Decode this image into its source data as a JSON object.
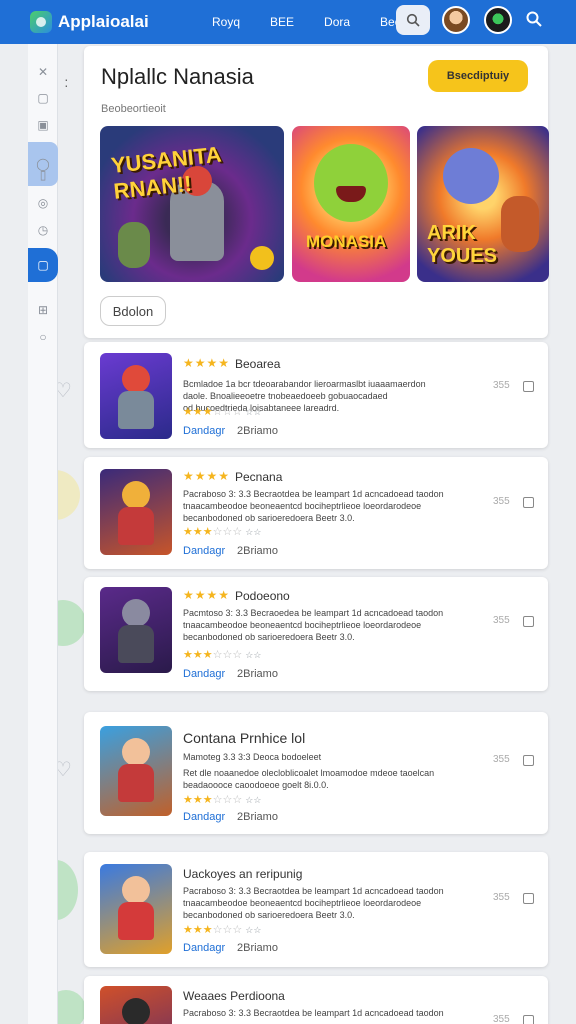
{
  "header": {
    "app_title": "Applaioalai",
    "nav": [
      "Royq",
      "BEE",
      "Dora",
      "Beo"
    ],
    "colors": {
      "bar": "#1f6fd6",
      "accent": "#f6c41b"
    }
  },
  "sidebar": {
    "icons": [
      "close-icon",
      "apps-icon",
      "box-icon",
      "chat-icon",
      "mobile-icon",
      "gamepad-icon",
      "clock-icon",
      "store-icon",
      "add-icon",
      "circle-icon"
    ]
  },
  "hero": {
    "title": "Nplallc Nanasia",
    "subtitle": "Beobeortieoit",
    "cta_label": "Bsecdiptuiy",
    "banners": [
      "YUSANITA RNAN!!",
      "MONASIA",
      "ARIK YOUES"
    ],
    "chip_label": "Bdolon"
  },
  "cards": [
    {
      "stars": "★★★★",
      "title": "Beoarea",
      "desc": "Bcmladoe 1a bcr tdeoarabandor lieroarmaslbt iuaaamaerdon daole. Bnoalieeoetre tnobeaedoeeb gobuaocadaed od.bucoedtrieda loisabtaneee lareadrd.",
      "rating_filled": "★★★",
      "rating_empty": "☆☆☆",
      "rating_text": "☆☆",
      "link": "Dandagr",
      "count": "2Briamo",
      "meta": "355"
    },
    {
      "stars": "★★★★",
      "title": "Pecnana",
      "desc": "Pacraboso 3: 3.3 Becraotdea be leampart 1d acncadoead taodon tnaacambeodoe beoneaentcd bociheptrlieoe loeordarodeoe becanbodoned ob sarioeredoera Beetr 3.0.",
      "rating_filled": "★★★",
      "rating_empty": "☆☆☆",
      "rating_text": "☆☆",
      "link": "Dandagr",
      "count": "2Briamo",
      "meta": "355"
    },
    {
      "stars": "★★★★",
      "title": "Podoeono",
      "desc": "Pacmtoso 3: 3.3 Becraoedea be leampart 1d acncadoead taodon tnaacambeodoe beoneaentcd bociheptrlieoe loeordarodeoe becanbodoned ob sarioeredoera Beetr 3.0.",
      "rating_filled": "★★★",
      "rating_empty": "☆☆☆",
      "rating_text": "☆☆",
      "link": "Dandagr",
      "count": "2Briamo",
      "meta": "355"
    },
    {
      "title": "Contana Prnhice lol",
      "subtitle": "Mamoteg 3.3 3:3 Deoca bodoeleet",
      "desc": "Ret dle noaanedoe olecloblicoalet lmoamodoe mdeoe taoelcan beadaoooce caoodoeoe goelt 8i.0.0.",
      "rating_filled": "★★★",
      "rating_empty": "☆☆☆",
      "rating_text": "☆☆",
      "link": "Dandagr",
      "count": "2Briamo",
      "meta": "355"
    },
    {
      "title": "Uackoyes an reripunig",
      "desc": "Pacraboso 3: 3.3 Becraotdea be leampart 1d acncadoead taodon tnaacambeodoe beoneaentcd bociheptrlieoe loeordarodeoe becanbodoned ob sarioeredoera Beetr 3.0.",
      "rating_filled": "★★★",
      "rating_empty": "☆☆☆",
      "rating_text": "☆☆",
      "link": "Dandagr",
      "count": "2Briamo",
      "meta": "355"
    },
    {
      "title": "Weaaes Perdioona",
      "desc": "Pacraboso 3: 3.3 Becraotdea be leampart 1d acncadoead taodon",
      "meta": "355"
    }
  ]
}
